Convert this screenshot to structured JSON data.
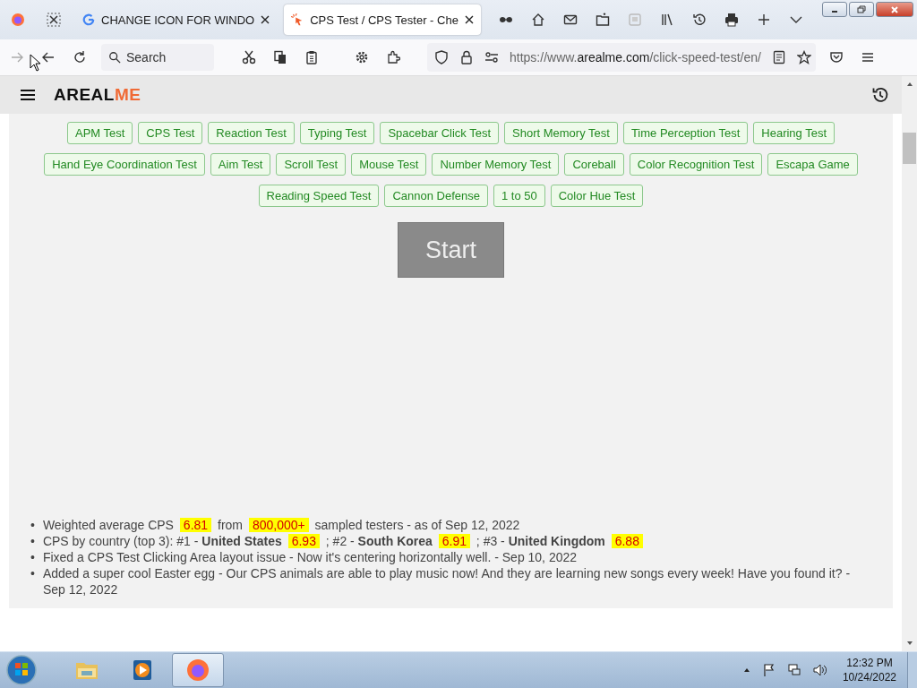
{
  "browser": {
    "tabs": [
      {
        "title": "CHANGE ICON FOR WINDO",
        "selected": false
      },
      {
        "title": "CPS Test / CPS Tester - Che",
        "selected": true
      }
    ],
    "search": {
      "placeholder": "Search"
    },
    "url": {
      "prefix": "https://www.",
      "domain": "arealme.com",
      "path": "/click-speed-test/en/"
    }
  },
  "site": {
    "logo": {
      "main": "AREAL",
      "accent": "ME"
    },
    "test_link_rows": [
      [
        "APM Test",
        "CPS Test",
        "Reaction Test",
        "Typing Test",
        "Spacebar Click Test",
        "Short Memory Test",
        "Time Perception Test",
        "Hearing Test"
      ],
      [
        "Hand Eye Coordination Test",
        "Aim Test",
        "Scroll Test",
        "Mouse Test",
        "Number Memory Test",
        "Coreball",
        "Color Recognition Test",
        "Escapa Game"
      ],
      [
        "Reading Speed Test",
        "Cannon Defense",
        "1 to 50",
        "Color Hue Test"
      ]
    ],
    "start_button": "Start",
    "news": [
      {
        "bullet": "•",
        "segments": [
          {
            "kind": "text",
            "text": "Weighted average CPS"
          },
          {
            "kind": "highlight",
            "text": "6.81"
          },
          {
            "kind": "text",
            "text": "from"
          },
          {
            "kind": "highlight",
            "text": "800,000+"
          },
          {
            "kind": "text",
            "text": "sampled testers - as of Sep 12, 2022"
          }
        ]
      },
      {
        "bullet": "•",
        "segments": [
          {
            "kind": "text",
            "text": "CPS by country (top 3): #1 -"
          },
          {
            "kind": "bold",
            "text": "United States"
          },
          {
            "kind": "highlight",
            "text": "6.93"
          },
          {
            "kind": "text",
            "text": "; #2 -"
          },
          {
            "kind": "bold",
            "text": "South Korea"
          },
          {
            "kind": "highlight",
            "text": "6.91"
          },
          {
            "kind": "text",
            "text": "; #3 -"
          },
          {
            "kind": "bold",
            "text": "United Kingdom"
          },
          {
            "kind": "highlight",
            "text": "6.88"
          }
        ]
      },
      {
        "bullet": "•",
        "segments": [
          {
            "kind": "text",
            "text": "Fixed a CPS Test Clicking Area layout issue - Now it's centering horizontally well. - Sep 10, 2022"
          }
        ]
      },
      {
        "bullet": "•",
        "segments": [
          {
            "kind": "text",
            "text": "Added a super cool Easter egg - Our CPS animals are able to play music now! And they are learning new songs every week! Have you found it? - Sep 12, 2022"
          }
        ]
      }
    ]
  },
  "taskbar": {
    "apps": [
      {
        "kind": "explorer",
        "selected": false
      },
      {
        "kind": "media",
        "selected": false
      },
      {
        "kind": "firefox",
        "selected": true
      }
    ],
    "time": "12:32 PM",
    "date": "10/24/2022"
  }
}
